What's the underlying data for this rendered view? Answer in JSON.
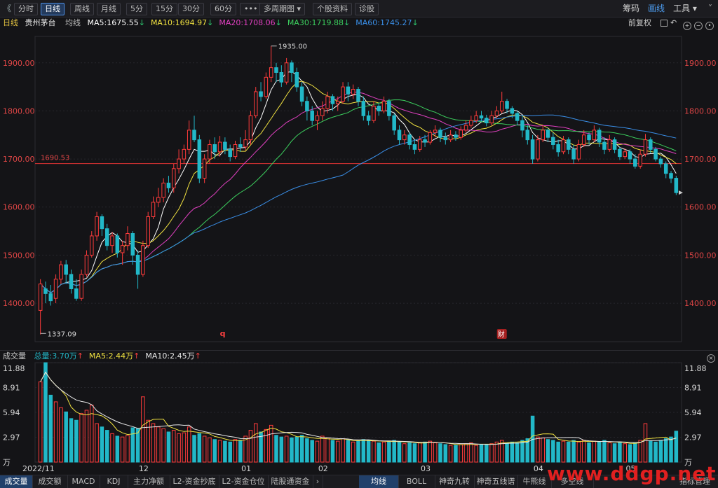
{
  "toolbar": {
    "back_glyph": "《",
    "tabs": [
      "分时",
      "日线",
      "周线",
      "月线",
      "5分",
      "15分",
      "30分",
      "60分"
    ],
    "active_tab": 1,
    "more": "•••",
    "multi_period": "多周期图",
    "stock_info": "个股资料",
    "diagnose": "诊股",
    "right": [
      "筹码",
      "画线",
      "工具"
    ]
  },
  "ma_bar": {
    "period": "日线",
    "stock_name": "贵州茅台",
    "avg_label": "均线",
    "items": [
      {
        "label": "MA5:1675.55",
        "color": "#ffffff"
      },
      {
        "label": "MA10:1694.97",
        "color": "#f0e140"
      },
      {
        "label": "MA20:1708.06",
        "color": "#e040c0"
      },
      {
        "label": "MA30:1719.88",
        "color": "#3ccf5e"
      },
      {
        "label": "MA60:1745.27",
        "color": "#3a8fe8"
      }
    ],
    "rehab": "前复权"
  },
  "vol_bar": {
    "title": "成交量",
    "items": [
      {
        "label": "总量:3.70万",
        "color": "#22b8c8"
      },
      {
        "label": "MA5:2.44万",
        "color": "#f0e140"
      },
      {
        "label": "MA10:2.45万",
        "color": "#e8e8e8"
      }
    ]
  },
  "bottom_tabs": [
    "成交量",
    "成交额",
    "MACD",
    "KDJ",
    "主力净额",
    "L2-资金抄底",
    "L2-资金仓位",
    "陆股通资金"
  ],
  "bottom_tabs_right": [
    "均线",
    "BOLL",
    "神奇九转",
    "神奇五线谱",
    "牛熊线",
    "多空线"
  ],
  "bottom_index_mgr": "指标管理",
  "watermark": "www.ddgp.net",
  "chart_data": {
    "type": "candlestick",
    "price_axis": {
      "ticks": [
        1900,
        1800,
        1700,
        1600,
        1500,
        1400
      ],
      "ylim": [
        1320,
        1955
      ]
    },
    "volume_axis": {
      "ticks": [
        "11.88",
        "8.91",
        "5.94",
        "2.97",
        "万"
      ],
      "ylim": [
        0,
        11.88
      ]
    },
    "x_labels": [
      {
        "label": "2022/11",
        "i": 0
      },
      {
        "label": "12",
        "i": 20
      },
      {
        "label": "01",
        "i": 40
      },
      {
        "label": "02",
        "i": 55
      },
      {
        "label": "03",
        "i": 75
      },
      {
        "label": "04",
        "i": 97
      },
      {
        "label": "05",
        "i": 115
      }
    ],
    "annotations": {
      "high": "1935.00",
      "low": "1337.09",
      "ref_line_label": "1690.53",
      "ref_line_value": 1690.53,
      "q_marker": "q",
      "cai_marker": "财"
    },
    "candles": [
      [
        1385,
        1440,
        1450,
        1335,
        9.6
      ],
      [
        1430,
        1420,
        1445,
        1400,
        11.88
      ],
      [
        1420,
        1405,
        1438,
        1395,
        8.0
      ],
      [
        1410,
        1450,
        1460,
        1400,
        7.2
      ],
      [
        1450,
        1480,
        1488,
        1440,
        6.5
      ],
      [
        1480,
        1460,
        1490,
        1440,
        6.0
      ],
      [
        1460,
        1430,
        1470,
        1420,
        5.2
      ],
      [
        1430,
        1410,
        1450,
        1405,
        5.0
      ],
      [
        1410,
        1460,
        1470,
        1405,
        5.8
      ],
      [
        1460,
        1500,
        1510,
        1455,
        6.2
      ],
      [
        1500,
        1540,
        1550,
        1495,
        6.8
      ],
      [
        1540,
        1580,
        1590,
        1530,
        4.6
      ],
      [
        1580,
        1555,
        1585,
        1540,
        4.2
      ],
      [
        1555,
        1520,
        1565,
        1510,
        3.8
      ],
      [
        1520,
        1540,
        1548,
        1505,
        3.4
      ],
      [
        1540,
        1505,
        1545,
        1495,
        3.1
      ],
      [
        1505,
        1520,
        1530,
        1480,
        3.0
      ],
      [
        1520,
        1545,
        1560,
        1510,
        3.2
      ],
      [
        1545,
        1500,
        1550,
        1480,
        4.1
      ],
      [
        1500,
        1460,
        1510,
        1430,
        4.0
      ],
      [
        1460,
        1520,
        1530,
        1455,
        7.8
      ],
      [
        1520,
        1580,
        1590,
        1515,
        5.0
      ],
      [
        1580,
        1610,
        1622,
        1575,
        4.6
      ],
      [
        1610,
        1620,
        1640,
        1600,
        4.2
      ],
      [
        1620,
        1650,
        1660,
        1610,
        4.0
      ],
      [
        1650,
        1640,
        1665,
        1630,
        3.6
      ],
      [
        1640,
        1680,
        1690,
        1630,
        3.8
      ],
      [
        1680,
        1700,
        1720,
        1670,
        3.4
      ],
      [
        1700,
        1720,
        1730,
        1690,
        3.5
      ],
      [
        1720,
        1760,
        1780,
        1710,
        4.2
      ],
      [
        1760,
        1740,
        1790,
        1735,
        3.2
      ],
      [
        1740,
        1660,
        1750,
        1650,
        3.4
      ],
      [
        1660,
        1700,
        1710,
        1650,
        3.1
      ],
      [
        1700,
        1730,
        1740,
        1690,
        2.9
      ],
      [
        1730,
        1715,
        1745,
        1700,
        2.7
      ],
      [
        1715,
        1735,
        1748,
        1705,
        2.6
      ],
      [
        1735,
        1720,
        1745,
        1710,
        2.5
      ],
      [
        1720,
        1705,
        1730,
        1695,
        2.4
      ],
      [
        1705,
        1730,
        1738,
        1700,
        2.7
      ],
      [
        1730,
        1725,
        1745,
        1715,
        2.6
      ],
      [
        1725,
        1740,
        1760,
        1718,
        3.1
      ],
      [
        1740,
        1790,
        1800,
        1730,
        3.8
      ],
      [
        1790,
        1840,
        1850,
        1785,
        4.6
      ],
      [
        1840,
        1830,
        1860,
        1820,
        3.6
      ],
      [
        1830,
        1870,
        1880,
        1825,
        3.9
      ],
      [
        1870,
        1890,
        1935,
        1860,
        4.4
      ],
      [
        1890,
        1880,
        1900,
        1860,
        3.2
      ],
      [
        1880,
        1860,
        1895,
        1850,
        3.0
      ],
      [
        1860,
        1900,
        1910,
        1855,
        3.1
      ],
      [
        1900,
        1880,
        1905,
        1860,
        2.9
      ],
      [
        1880,
        1850,
        1890,
        1840,
        3.0
      ],
      [
        1850,
        1820,
        1860,
        1810,
        3.2
      ],
      [
        1820,
        1800,
        1830,
        1780,
        2.8
      ],
      [
        1800,
        1780,
        1810,
        1770,
        2.6
      ],
      [
        1780,
        1790,
        1800,
        1760,
        2.5
      ],
      [
        1790,
        1805,
        1820,
        1780,
        3.1
      ],
      [
        1805,
        1830,
        1840,
        1795,
        2.9
      ],
      [
        1830,
        1815,
        1835,
        1800,
        2.6
      ],
      [
        1815,
        1820,
        1830,
        1800,
        2.5
      ],
      [
        1820,
        1850,
        1860,
        1815,
        2.8
      ],
      [
        1850,
        1835,
        1860,
        1820,
        2.6
      ],
      [
        1835,
        1845,
        1855,
        1825,
        2.4
      ],
      [
        1845,
        1820,
        1850,
        1810,
        2.5
      ],
      [
        1820,
        1790,
        1830,
        1780,
        2.7
      ],
      [
        1790,
        1780,
        1800,
        1770,
        2.6
      ],
      [
        1780,
        1810,
        1820,
        1775,
        2.5
      ],
      [
        1810,
        1800,
        1815,
        1790,
        2.3
      ],
      [
        1800,
        1820,
        1830,
        1795,
        2.4
      ],
      [
        1820,
        1790,
        1825,
        1780,
        2.5
      ],
      [
        1790,
        1760,
        1795,
        1750,
        2.6
      ],
      [
        1760,
        1740,
        1770,
        1730,
        2.4
      ],
      [
        1740,
        1750,
        1760,
        1730,
        2.2
      ],
      [
        1750,
        1730,
        1755,
        1720,
        2.3
      ],
      [
        1730,
        1720,
        1740,
        1710,
        2.2
      ],
      [
        1720,
        1740,
        1748,
        1715,
        2.3
      ],
      [
        1740,
        1735,
        1750,
        1725,
        2.4
      ],
      [
        1735,
        1755,
        1760,
        1730,
        2.5
      ],
      [
        1755,
        1760,
        1770,
        1745,
        2.3
      ],
      [
        1760,
        1745,
        1765,
        1735,
        2.2
      ],
      [
        1745,
        1740,
        1755,
        1730,
        2.1
      ],
      [
        1740,
        1750,
        1760,
        1735,
        2.0
      ],
      [
        1750,
        1745,
        1758,
        1738,
        2.0
      ],
      [
        1745,
        1760,
        1768,
        1740,
        2.1
      ],
      [
        1760,
        1770,
        1780,
        1755,
        2.2
      ],
      [
        1770,
        1780,
        1790,
        1765,
        2.3
      ],
      [
        1780,
        1790,
        1800,
        1775,
        2.0
      ],
      [
        1790,
        1785,
        1800,
        1778,
        2.1
      ],
      [
        1785,
        1775,
        1792,
        1768,
        2.1
      ],
      [
        1775,
        1790,
        1800,
        1770,
        2.2
      ],
      [
        1790,
        1800,
        1810,
        1785,
        2.4
      ],
      [
        1800,
        1820,
        1840,
        1795,
        2.6
      ],
      [
        1820,
        1805,
        1825,
        1795,
        2.3
      ],
      [
        1805,
        1795,
        1810,
        1785,
        2.4
      ],
      [
        1795,
        1780,
        1800,
        1770,
        2.3
      ],
      [
        1780,
        1760,
        1790,
        1745,
        2.6
      ],
      [
        1760,
        1740,
        1770,
        1730,
        2.8
      ],
      [
        1740,
        1700,
        1750,
        1690,
        5.5
      ],
      [
        1700,
        1740,
        1750,
        1695,
        3.0
      ],
      [
        1740,
        1760,
        1770,
        1735,
        2.9
      ],
      [
        1760,
        1745,
        1765,
        1735,
        2.7
      ],
      [
        1745,
        1730,
        1755,
        1720,
        2.6
      ],
      [
        1730,
        1715,
        1740,
        1705,
        2.4
      ],
      [
        1715,
        1740,
        1748,
        1710,
        2.5
      ],
      [
        1740,
        1720,
        1745,
        1710,
        2.4
      ],
      [
        1720,
        1700,
        1730,
        1690,
        2.6
      ],
      [
        1700,
        1730,
        1740,
        1695,
        2.4
      ],
      [
        1730,
        1750,
        1760,
        1725,
        2.6
      ],
      [
        1750,
        1740,
        1755,
        1730,
        2.3
      ],
      [
        1740,
        1760,
        1770,
        1735,
        2.5
      ],
      [
        1760,
        1735,
        1765,
        1725,
        2.4
      ],
      [
        1735,
        1720,
        1745,
        1710,
        2.6
      ],
      [
        1720,
        1740,
        1750,
        1715,
        2.3
      ],
      [
        1740,
        1720,
        1745,
        1712,
        2.2
      ],
      [
        1720,
        1705,
        1725,
        1698,
        2.4
      ],
      [
        1705,
        1715,
        1722,
        1700,
        2.2
      ],
      [
        1715,
        1700,
        1720,
        1690,
        2.1
      ],
      [
        1700,
        1685,
        1710,
        1680,
        2.3
      ],
      [
        1685,
        1710,
        1720,
        1680,
        2.6
      ],
      [
        1710,
        1740,
        1752,
        1705,
        4.6
      ],
      [
        1740,
        1720,
        1745,
        1712,
        2.5
      ],
      [
        1720,
        1700,
        1725,
        1695,
        2.4
      ],
      [
        1700,
        1690,
        1705,
        1682,
        2.6
      ],
      [
        1690,
        1670,
        1695,
        1660,
        2.8
      ],
      [
        1670,
        1660,
        1675,
        1650,
        3.0
      ],
      [
        1660,
        1630,
        1665,
        1625,
        3.7
      ]
    ]
  }
}
